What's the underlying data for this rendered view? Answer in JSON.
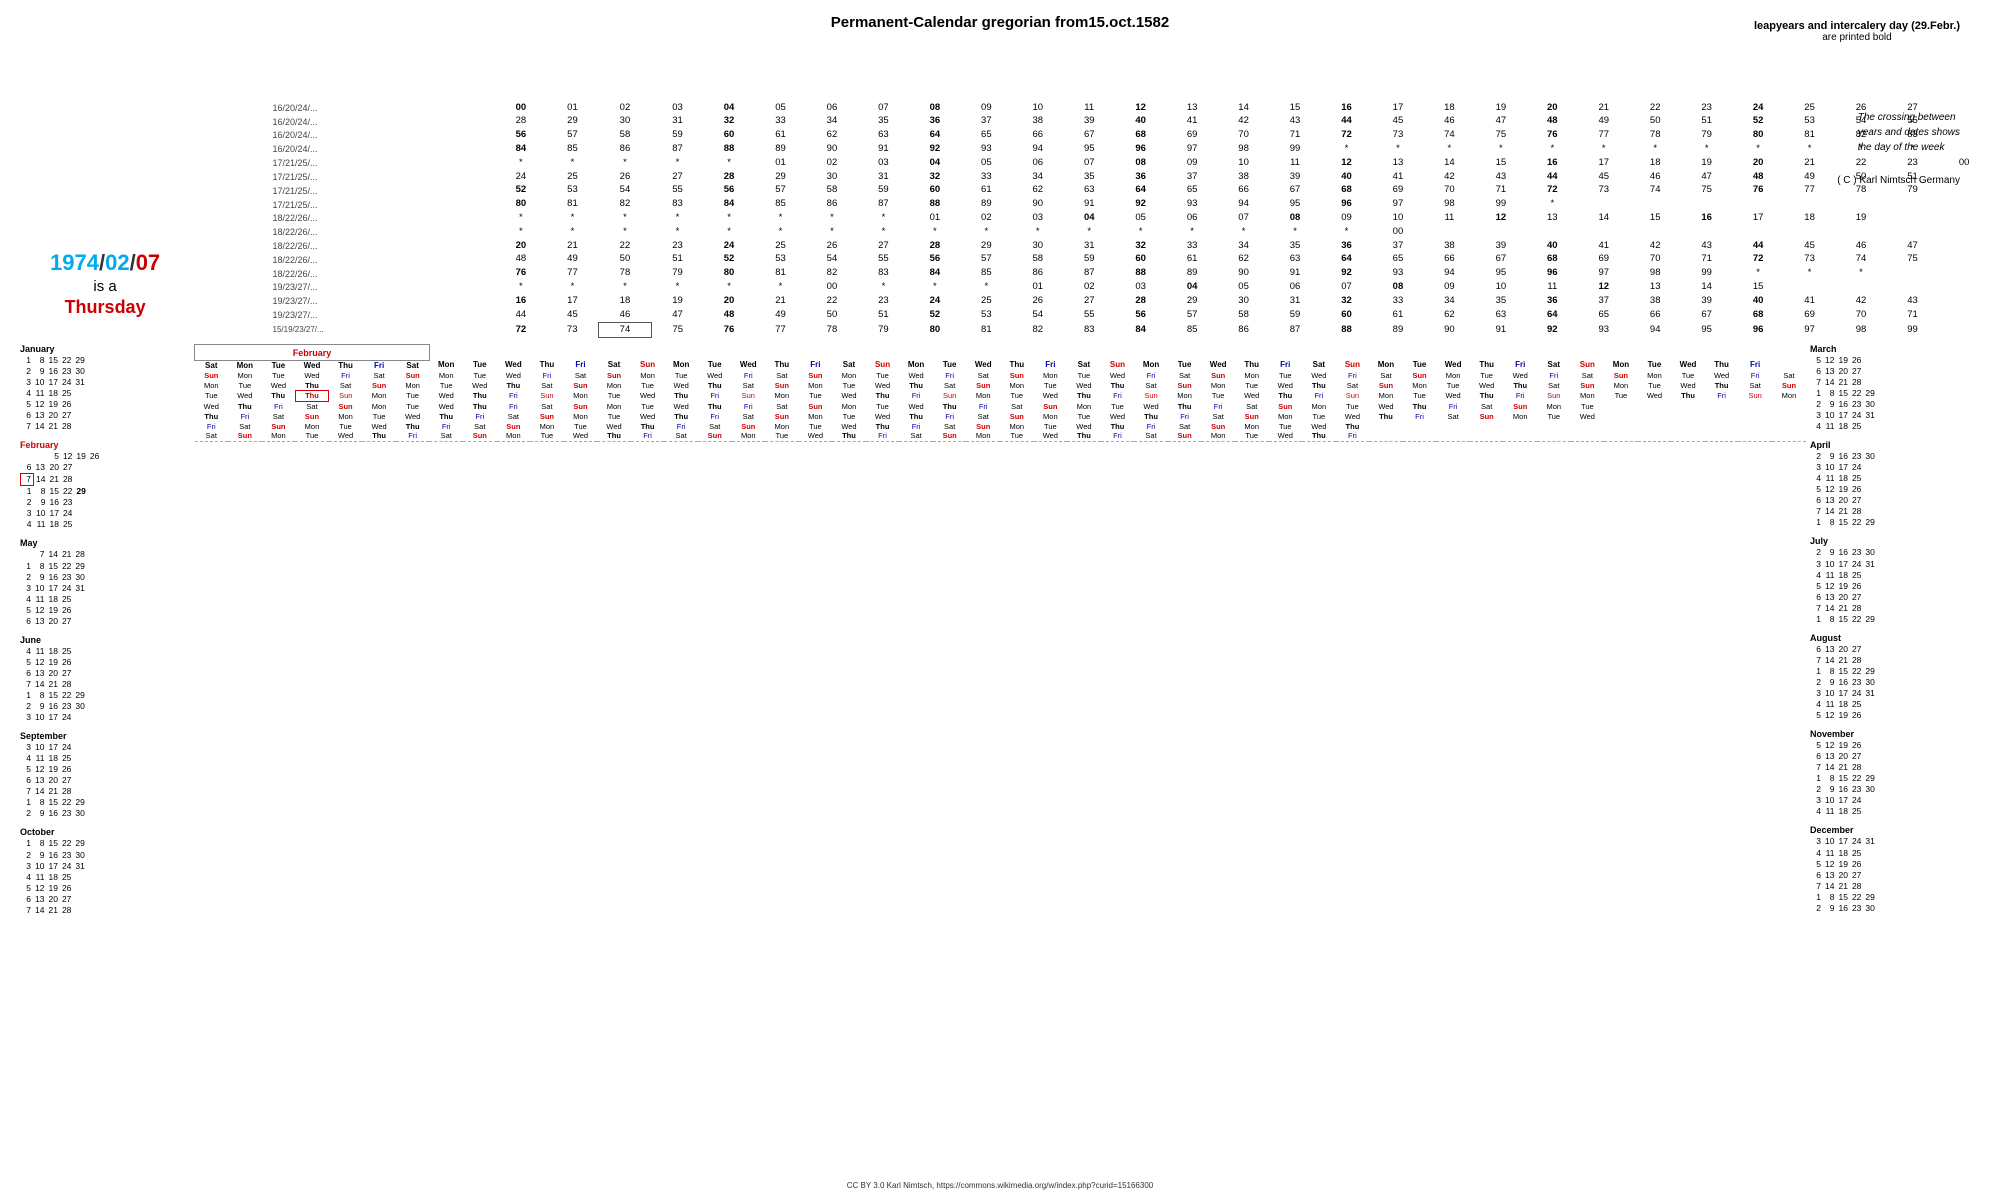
{
  "title": "Permanent-Calendar gregorian from15.oct.1582",
  "leap_note_line1": "leapyears and intercalery day (29.Febr.)",
  "leap_note_line2": "are printed bold",
  "crossing_note": "The crossing between\nyears and dates shows\nthe day of the week",
  "copyright": "( C ) Karl Nimtsch     Germany",
  "footer": "CC BY 3.0 Karl Nimtsch, https://commons.wikimedia.org/w/index.php?curid=15166300",
  "date_display": {
    "year": "1974",
    "month": "02",
    "day": "07",
    "is_a": "is a",
    "day_of_week": "Thursday"
  }
}
